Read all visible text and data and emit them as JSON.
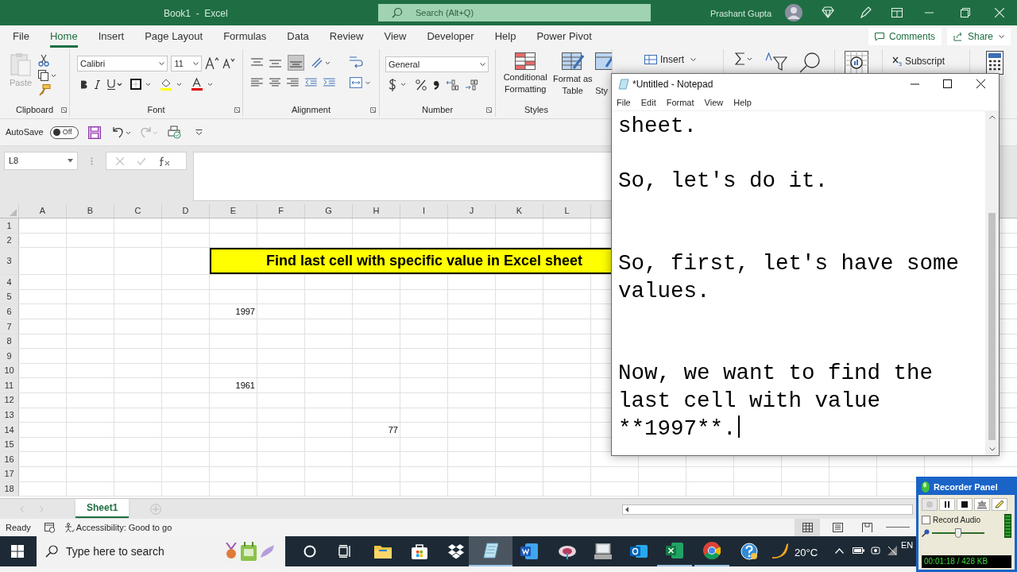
{
  "title_bar": {
    "title": "Book1  -  Excel",
    "search_placeholder": "Search (Alt+Q)",
    "user": "Prashant Gupta"
  },
  "ribbon_tabs": [
    {
      "label": "File",
      "selected": false
    },
    {
      "label": "Home",
      "selected": true
    },
    {
      "label": "Insert",
      "selected": false
    },
    {
      "label": "Page Layout",
      "selected": false
    },
    {
      "label": "Formulas",
      "selected": false
    },
    {
      "label": "Data",
      "selected": false
    },
    {
      "label": "Review",
      "selected": false
    },
    {
      "label": "View",
      "selected": false
    },
    {
      "label": "Developer",
      "selected": false
    },
    {
      "label": "Help",
      "selected": false
    },
    {
      "label": "Power Pivot",
      "selected": false
    }
  ],
  "comments_button": "Comments",
  "share_button": "Share",
  "ribbon": {
    "paste": "Paste",
    "font_name": "Calibri",
    "font_size": "11",
    "number_format": "General",
    "conditional_formatting": "Conditional Formatting",
    "format_as_table": "Format as Table",
    "cell_styles": "Sty",
    "insert": "Insert",
    "subscript": "Subscript",
    "groups": [
      "Clipboard",
      "Font",
      "Alignment",
      "Number",
      "Styles"
    ]
  },
  "quick_access": {
    "autosave": "AutoSave",
    "autosave_state": "Off",
    "autosave_on": false
  },
  "name_box": "L8",
  "sheet": {
    "columns": [
      "A",
      "B",
      "C",
      "D",
      "E",
      "F",
      "G",
      "H",
      "I",
      "J",
      "K",
      "L"
    ],
    "rows": [
      {
        "label": "1"
      },
      {
        "label": "2"
      },
      {
        "label": "3",
        "title_cell": "Find last cell with specific value in Excel sheet"
      },
      {
        "label": "4"
      },
      {
        "label": "5"
      },
      {
        "label": "6",
        "column_e": "1997"
      },
      {
        "label": "7"
      },
      {
        "label": "8"
      },
      {
        "label": "9"
      },
      {
        "label": "10"
      },
      {
        "label": "11",
        "column_e": "1961"
      },
      {
        "label": "12"
      },
      {
        "label": "13"
      },
      {
        "label": "14",
        "column_h": "77"
      },
      {
        "label": "15"
      },
      {
        "label": "16"
      },
      {
        "label": "17"
      },
      {
        "label": "18"
      }
    ]
  },
  "sheet_tabs": [
    {
      "label": "Sheet1",
      "selected": true
    }
  ],
  "status_bar": {
    "ready": "Ready",
    "accessibility": "Accessibility: Good to go"
  },
  "taskbar": {
    "search_placeholder": "Type here to search",
    "weather": "20°C",
    "language": "EN"
  },
  "notepad": {
    "title": "*Untitled - Notepad",
    "menu": [
      "File",
      "Edit",
      "Format",
      "View",
      "Help"
    ],
    "text": "sheet.\n\nSo, let's do it.\n\n\nSo, first, let's have some values.\n\n\nNow, we want to find the last cell with value **1997**."
  },
  "recorder": {
    "title": "Recorder Panel",
    "record_audio": "Record Audio",
    "record_audio_checked": false,
    "volume": {
      "level": 0.5
    },
    "time": "00:01:18 / 428 KB"
  }
}
